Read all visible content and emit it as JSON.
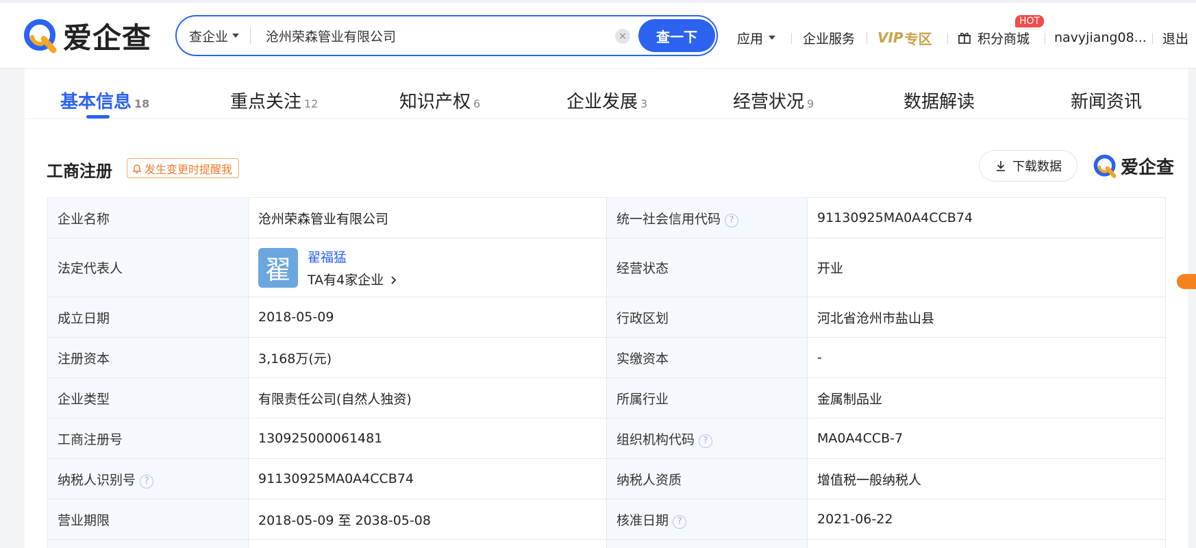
{
  "header": {
    "logo_text": "爱企查",
    "search_type": "查企业",
    "search_value": "沧州荣森管业有限公司",
    "search_clear": "×",
    "search_button": "查一下",
    "nav": {
      "apps": "应用",
      "enterprise_service": "企业服务",
      "vip": "VIP",
      "vip_zone": "专区",
      "points_mall": "积分商城",
      "hot_badge": "HOT",
      "username": "navyjiang08...",
      "logout": "退出"
    }
  },
  "tabs": [
    {
      "label": "基本信息",
      "count": "18"
    },
    {
      "label": "重点关注",
      "count": "12"
    },
    {
      "label": "知识产权",
      "count": "6"
    },
    {
      "label": "企业发展",
      "count": "3"
    },
    {
      "label": "经营状况",
      "count": "9"
    },
    {
      "label": "数据解读",
      "count": ""
    },
    {
      "label": "新闻资讯",
      "count": ""
    }
  ],
  "section": {
    "title": "工商注册",
    "remind": "发生变更时提醒我",
    "download": "下载数据",
    "brand": "爱企查"
  },
  "table": {
    "rows": [
      {
        "k1": "企业名称",
        "v1": "沧州荣森管业有限公司",
        "k2": "统一社会信用代码",
        "v2": "91130925MA0A4CCB74"
      },
      {
        "k1": "法定代表人",
        "avatar": "翟",
        "person": "翟福猛",
        "person_count": "TA有4家企业",
        "k2": "经营状态",
        "v2": "开业"
      },
      {
        "k1": "成立日期",
        "v1": "2018-05-09",
        "k2": "行政区划",
        "v2": "河北省沧州市盐山县"
      },
      {
        "k1": "注册资本",
        "v1": "3,168万(元)",
        "k2": "实缴资本",
        "v2": "-"
      },
      {
        "k1": "企业类型",
        "v1": "有限责任公司(自然人独资)",
        "k2": "所属行业",
        "v2": "金属制品业"
      },
      {
        "k1": "工商注册号",
        "v1": "130925000061481",
        "k2": "组织机构代码",
        "v2": "MA0A4CCB-7"
      },
      {
        "k1": "纳税人识别号",
        "v1": "91130925MA0A4CCB74",
        "k2": "纳税人资质",
        "v2": "增值税一般纳税人"
      },
      {
        "k1": "营业期限",
        "v1": "2018-05-09 至 2038-05-08",
        "k2": "核准日期",
        "v2": "2021-06-22"
      }
    ]
  },
  "colors": {
    "accent": "#2b63f0",
    "remind": "#f07b2e",
    "vip": "#c8a34a",
    "hot": "#f54a4a"
  }
}
